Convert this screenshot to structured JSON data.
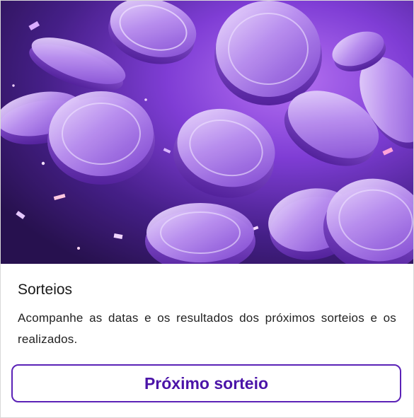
{
  "card": {
    "image": {
      "subject": "purple-coins-confetti",
      "palette": {
        "background_dark": "#2a0d5a",
        "background_mid": "#6b2ec9",
        "glow": "#c77dff",
        "coin_fill": "#b48be8",
        "coin_edge": "#7b3fcf",
        "coin_highlight": "#efe1ff"
      }
    },
    "title": "Sorteios",
    "description": "Acompanhe as datas e os resultados dos próximos sorteios e os realizados.",
    "cta_label": "Próximo sorteio",
    "accent_color": "#5b22b7"
  }
}
